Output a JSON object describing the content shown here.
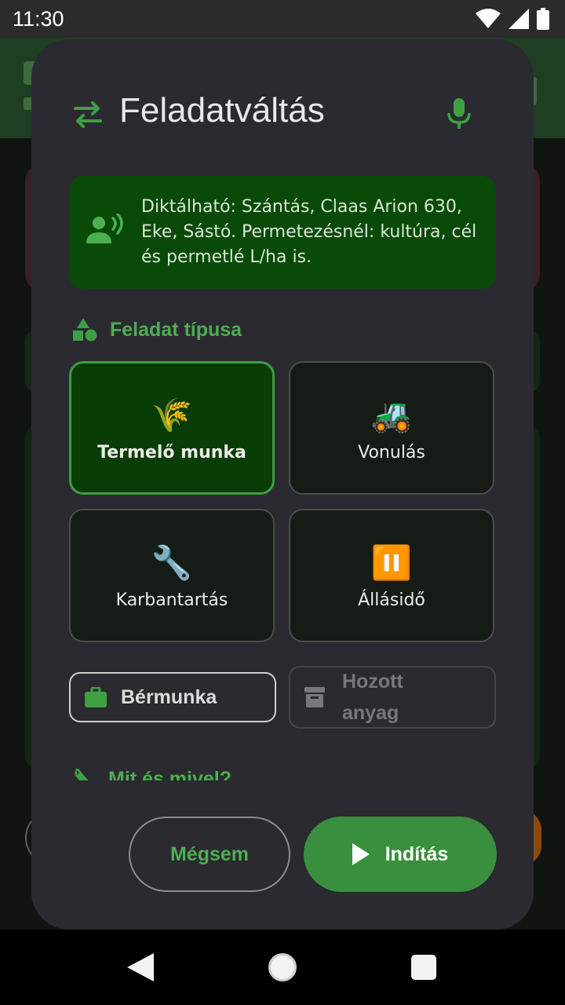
{
  "status_bar": {
    "time": "11:30",
    "icons": [
      "wifi-icon",
      "signal-icon",
      "battery-icon"
    ]
  },
  "dialog": {
    "title": "Feladatváltás",
    "title_icon": "swap-arrows-icon",
    "action_icon": "microphone-icon",
    "info": {
      "icon": "voice-person-icon",
      "text": "Diktálható: Szántás, Claas Arion 630, Eke, Sástó. Permetezésnél: kultúra, cél és permetlé L/ha is."
    },
    "task_type_section": {
      "label": "Feladat típusa",
      "icon": "shapes-icon"
    },
    "task_types": [
      {
        "label": "Termelő munka",
        "emoji": "🌾",
        "selected": true
      },
      {
        "label": "Vonulás",
        "emoji": "🚜",
        "selected": false
      },
      {
        "label": "Karbantartás",
        "emoji": "🔧",
        "selected": false
      },
      {
        "label": "Állásidő",
        "emoji": "⏸️",
        "selected": false
      }
    ],
    "chips": {
      "bermunka": {
        "label": "Bérmunka",
        "icon": "briefcase-icon"
      },
      "hozott_anyag": {
        "label": "Hozott anyag",
        "icon": "archive-box-icon"
      }
    },
    "next_section": {
      "label": "Mit és mivel?",
      "icon": "wrench-icon"
    },
    "buttons": {
      "cancel": "Mégsem",
      "start": "Indítás"
    }
  },
  "colors": {
    "accent_green": "#4caf50",
    "primary_button": "#3a8f3e",
    "dialog_bg": "#2a2a30",
    "info_bg": "#0a4a08"
  }
}
